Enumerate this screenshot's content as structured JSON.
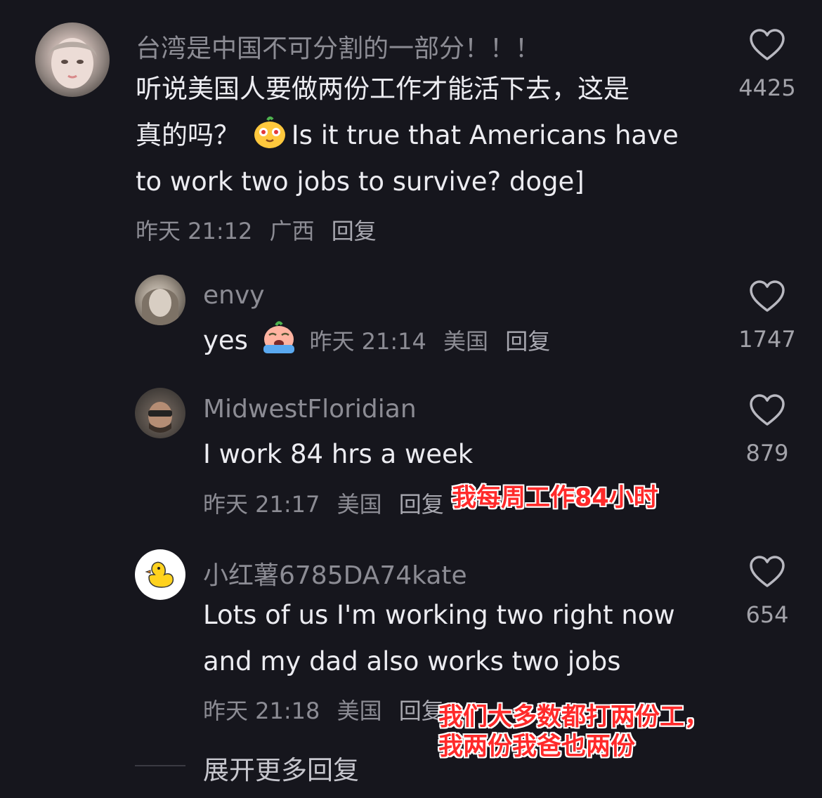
{
  "comment_main": {
    "username": "台湾是中国不可分割的一部分！！！",
    "line1": "听说美国人要做两份工作才能活下去，这是",
    "line2_prefix": "真的吗？",
    "line2_suffix": "Is it true that Americans have",
    "line3": "to work two jobs to survive? doge]",
    "time": "昨天 21:12",
    "location": "广西",
    "reply": "回复",
    "likes": "4425"
  },
  "reply_envy": {
    "username": "envy",
    "text": "yes",
    "time": "昨天 21:14",
    "location": "美国",
    "reply": "回复",
    "likes": "1747"
  },
  "reply_midwest": {
    "username": "MidwestFloridian",
    "text": "I work 84 hrs a week",
    "time": "昨天 21:17",
    "location": "美国",
    "reply": "回复",
    "likes": "879",
    "caption": "我每周工作84小时"
  },
  "reply_kate": {
    "username": "小红薯6785DA74kate",
    "line1": "Lots of us I'm working two right now",
    "line2": "and my dad also works two jobs",
    "time": "昨天 21:18",
    "location": "美国",
    "reply": "回复",
    "likes": "654",
    "caption_line1": "我们大多数都打两份工，",
    "caption_line2": "我两份我爸也两份"
  },
  "expand_more": "展开更多回复",
  "icons": {
    "like": "heart-outline-icon",
    "emoji_main": "smirk-face-emoji",
    "emoji_envy": "crying-face-emoji",
    "avatar_duck": "duck-icon"
  },
  "colors": {
    "background": "#16161d",
    "text_primary": "#ececf1",
    "text_secondary": "#8c8c94",
    "caption_red": "#ff2a2a"
  }
}
